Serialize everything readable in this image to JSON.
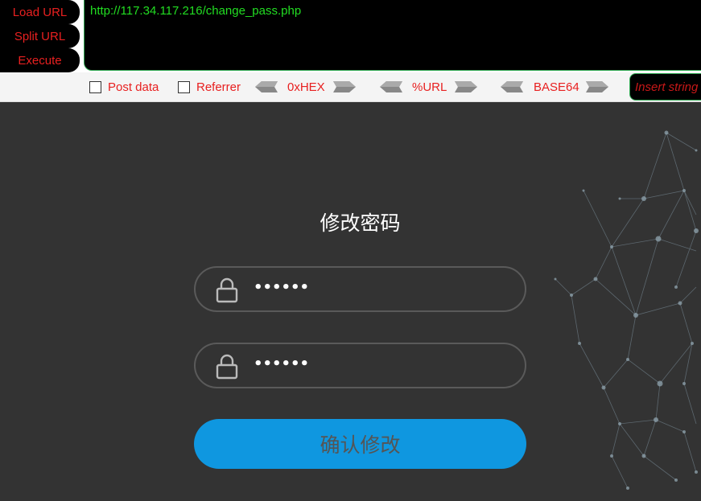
{
  "hackbar": {
    "load_url": "Load URL",
    "split_url": "Split URL",
    "execute": "Execute",
    "url_value": "http://117.34.117.216/change_pass.php",
    "post_data": "Post data",
    "referrer": "Referrer",
    "hex": "0xHEX",
    "url_encode": "%URL",
    "base64": "BASE64",
    "insert_placeholder": "Insert string"
  },
  "form": {
    "title": "修改密码",
    "password_mask_1": "••••••",
    "password_mask_2": "••••••",
    "submit_label": "确认修改"
  },
  "colors": {
    "hackbar_text": "#e82020",
    "url_text": "#22dd22",
    "page_bg": "#333333",
    "button_bg": "#0f97e0"
  }
}
